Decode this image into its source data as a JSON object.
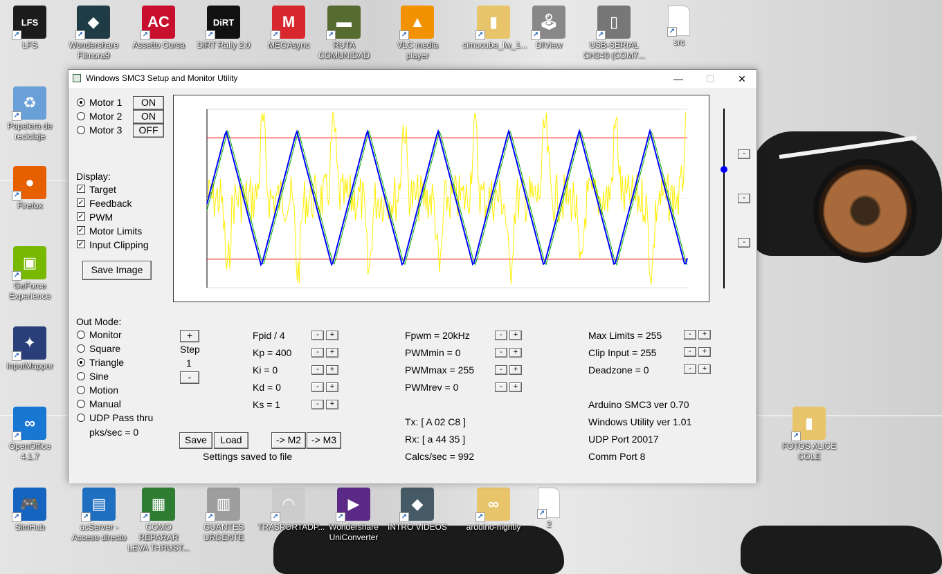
{
  "desktop": {
    "icons": [
      {
        "label": "LFS",
        "color": "#1c1c1c",
        "glyph": "LFS"
      },
      {
        "label": "Wondershare Filmora9",
        "color": "#1f3b45",
        "glyph": "◆"
      },
      {
        "label": "Assetto Corsa",
        "color": "#c8102e",
        "glyph": "AC"
      },
      {
        "label": "DiRT Rally 2.0",
        "color": "#111111",
        "glyph": "DiRT"
      },
      {
        "label": "MEGAsync",
        "color": "#d9272e",
        "glyph": "M"
      },
      {
        "label": "RUTA COMUNIDAD",
        "color": "#556b2f",
        "glyph": "▬"
      },
      {
        "label": "VLC media player",
        "color": "#f39200",
        "glyph": "▲"
      },
      {
        "label": "simucube_fw_1...",
        "color": "#e8c46a",
        "glyph": "▮"
      },
      {
        "label": "DIView",
        "color": "#888888",
        "glyph": "🕹"
      },
      {
        "label": "USB-SERIAL CH340 (COM7...",
        "color": "#777777",
        "glyph": "▯"
      },
      {
        "label": "src",
        "color": "#ffffff",
        "glyph": ""
      },
      {
        "label": "Papelera de reciclaje",
        "color": "#6aa0d8",
        "glyph": "♻"
      },
      {
        "label": "Firefox",
        "color": "#e66000",
        "glyph": "●"
      },
      {
        "label": "GeForce Experience",
        "color": "#76b900",
        "glyph": "▣"
      },
      {
        "label": "InputMapper",
        "color": "#2a3f7a",
        "glyph": "✦"
      },
      {
        "label": "OpenOffice 4.1.7",
        "color": "#1877d2",
        "glyph": "∞"
      },
      {
        "label": "SimHub",
        "color": "#1565c0",
        "glyph": "🎮"
      },
      {
        "label": "acServer - Acceso directo",
        "color": "#1e6fc0",
        "glyph": "▤"
      },
      {
        "label": "COMO REPARAR LEVA THRUST...",
        "color": "#2e7d32",
        "glyph": "▦"
      },
      {
        "label": "GUANTES URGENTE",
        "color": "#9e9e9e",
        "glyph": "▥"
      },
      {
        "label": "TRASPORTADP...",
        "color": "#cccccc",
        "glyph": "◠"
      },
      {
        "label": "Wondershare UniConverter",
        "color": "#5b2a86",
        "glyph": "▶"
      },
      {
        "label": "INTRO VIDEOS",
        "color": "#455a64",
        "glyph": "◆"
      },
      {
        "label": "arduino-nightly",
        "color": "#e8c46a",
        "glyph": "∞"
      },
      {
        "label": "2",
        "color": "#ffffff",
        "glyph": ""
      },
      {
        "label": "FOTOS ALICE COLE",
        "color": "#e8c46a",
        "glyph": "▮"
      }
    ]
  },
  "window": {
    "title": "Windows SMC3 Setup and Monitor Utility",
    "controls": {
      "minimize": "—",
      "maximize": "☐",
      "close": "✕"
    }
  },
  "motors": [
    {
      "label": "Motor 1",
      "state": "ON",
      "selected": true
    },
    {
      "label": "Motor 2",
      "state": "ON",
      "selected": false
    },
    {
      "label": "Motor 3",
      "state": "OFF",
      "selected": false
    }
  ],
  "display": {
    "heading": "Display:",
    "options": [
      {
        "label": "Target",
        "checked": true
      },
      {
        "label": "Feedback",
        "checked": true
      },
      {
        "label": "PWM",
        "checked": true
      },
      {
        "label": "Motor Limits",
        "checked": true
      },
      {
        "label": "Input Clipping",
        "checked": true
      }
    ],
    "save_image": "Save Image"
  },
  "out_mode": {
    "heading": "Out Mode:",
    "options": [
      {
        "label": "Monitor",
        "selected": false
      },
      {
        "label": "Square",
        "selected": false
      },
      {
        "label": "Triangle",
        "selected": true
      },
      {
        "label": "Sine",
        "selected": false
      },
      {
        "label": "Motion",
        "selected": false
      },
      {
        "label": "Manual",
        "selected": false
      },
      {
        "label": "UDP Pass thru",
        "selected": false
      }
    ],
    "pks": "pks/sec = 0"
  },
  "step": {
    "plus": "+",
    "label": "Step",
    "value": "1",
    "minus": "-"
  },
  "pid": [
    {
      "label": "Fpid / 4"
    },
    {
      "label": "Kp = 400"
    },
    {
      "label": "Ki = 0"
    },
    {
      "label": "Kd = 0"
    },
    {
      "label": "Ks = 1"
    }
  ],
  "pwm": [
    {
      "label": "Fpwm = 20kHz"
    },
    {
      "label": "PWMmin = 0"
    },
    {
      "label": "PWMmax = 255"
    },
    {
      "label": "PWMrev = 0"
    }
  ],
  "limits": [
    {
      "label": "Max Limits = 255"
    },
    {
      "label": "Clip Input = 255"
    },
    {
      "label": "Deadzone = 0"
    }
  ],
  "info": {
    "arduino": "Arduino SMC3 ver 0.70",
    "utility": "Windows Utility ver 1.01",
    "udp": "UDP Port 20017",
    "comm": "Comm Port 8",
    "tx": "Tx: [ A 02 C8 ]",
    "rx": "Rx: [ a 44 35 ]",
    "calcs": "Calcs/sec = 992"
  },
  "bottom_buttons": {
    "save": "Save",
    "load": "Load",
    "m2": "-> M2",
    "m3": "-> M3",
    "status": "Settings saved to file"
  },
  "spin": {
    "minus": "-",
    "plus": "+"
  },
  "slider_buttons": [
    "-",
    "-",
    "-"
  ],
  "chart_data": {
    "type": "line",
    "series": [
      {
        "role": "target",
        "color": "#0000ff",
        "shape": "triangle wave",
        "period": 2
      },
      {
        "role": "feedback",
        "color": "#00b000",
        "shape": "triangle wave, slightly lagging",
        "period": 2
      },
      {
        "role": "pwm",
        "color": "#ffee00",
        "shape": "noisy spikes",
        "period": 2
      }
    ],
    "x": {
      "cycles": 6.8
    },
    "target_range": [
      0.08,
      0.32
    ],
    "limits": {
      "upper": 0.16,
      "lower": 0.84,
      "color": "#ff0000"
    },
    "centerline": 0.5,
    "grid": false
  },
  "colors": {
    "accent": "#0000ff",
    "window_bg": "#f0f0f0"
  }
}
